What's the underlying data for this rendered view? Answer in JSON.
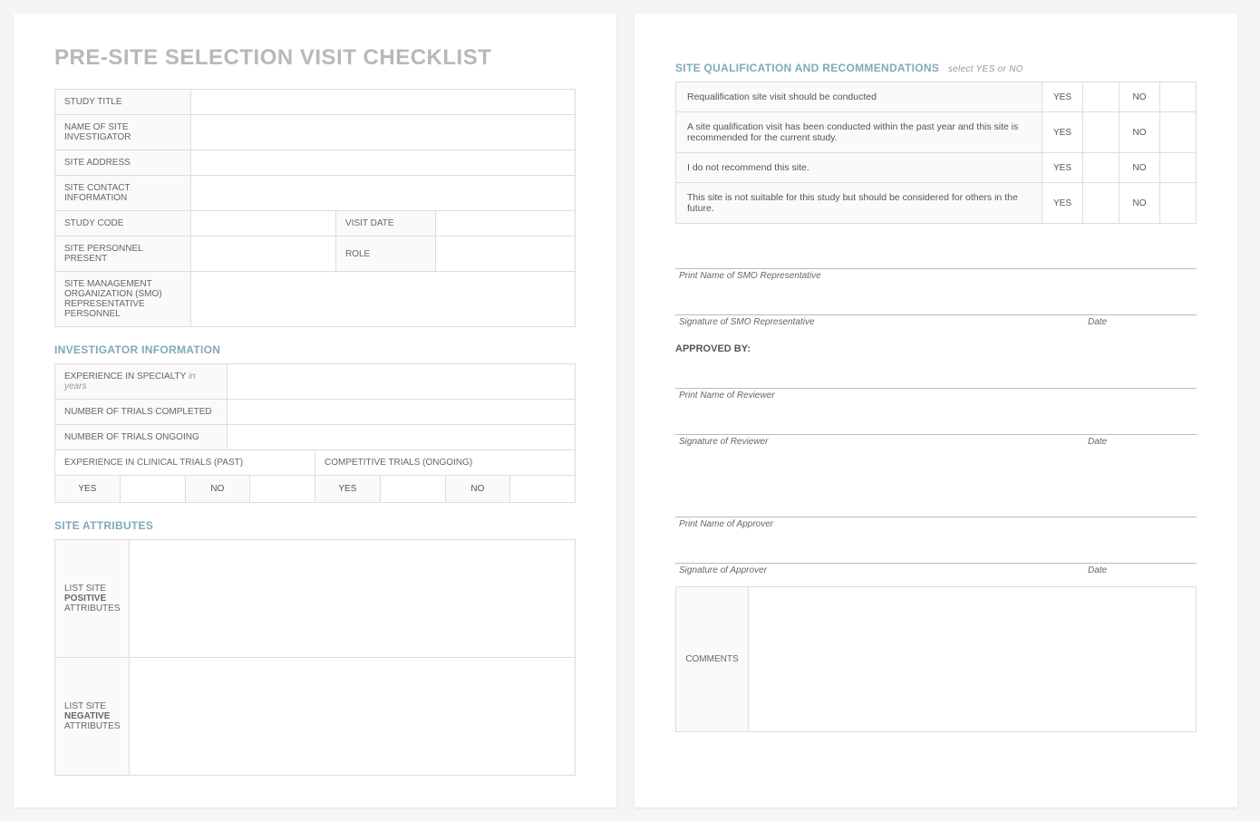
{
  "title": "PRE-SITE SELECTION VISIT CHECKLIST",
  "header": {
    "study_title": "STUDY TITLE",
    "name_investigator": "NAME OF SITE INVESTIGATOR",
    "site_address": "SITE ADDRESS",
    "site_contact": "SITE CONTACT INFORMATION",
    "study_code": "STUDY CODE",
    "visit_date": "VISIT DATE",
    "personnel_present": "SITE PERSONNEL PRESENT",
    "role": "ROLE",
    "smo_rep": "SITE MANAGEMENT ORGANIZATION (SMO) REPRESENTATIVE PERSONNEL"
  },
  "investigator": {
    "title": "INVESTIGATOR INFORMATION",
    "exp_specialty": "EXPERIENCE IN SPECIALTY",
    "exp_specialty_hint": "in years",
    "trials_completed": "NUMBER OF TRIALS COMPLETED",
    "trials_ongoing": "NUMBER OF TRIALS ONGOING",
    "exp_past": "EXPERIENCE IN CLINICAL TRIALS (PAST)",
    "comp_ongoing": "COMPETITIVE TRIALS (ONGOING)",
    "yes": "YES",
    "no": "NO"
  },
  "attributes": {
    "title": "SITE ATTRIBUTES",
    "positive_pre": "LIST SITE",
    "positive_bold": "POSITIVE",
    "positive_post": "ATTRIBUTES",
    "negative_pre": "LIST SITE",
    "negative_bold": "NEGATIVE",
    "negative_post": "ATTRIBUTES"
  },
  "qualification": {
    "title": "SITE QUALIFICATION AND RECOMMENDATIONS",
    "hint": "select YES or NO",
    "yes": "YES",
    "no": "NO",
    "items": [
      "Requalification site visit should be conducted",
      "A site qualification visit has been conducted within the past year and this site is recommended for the current study.",
      "I do not recommend this site.",
      "This site is not suitable for this study but should be considered for others in the future."
    ]
  },
  "signatures": {
    "print_smo": "Print Name of SMO Representative",
    "sig_smo": "Signature of SMO Representative",
    "approved_by": "APPROVED BY:",
    "print_reviewer": "Print Name of Reviewer",
    "sig_reviewer": "Signature of Reviewer",
    "print_approver": "Print Name of Approver",
    "sig_approver": "Signature of Approver",
    "date": "Date"
  },
  "comments": {
    "label": "COMMENTS"
  }
}
